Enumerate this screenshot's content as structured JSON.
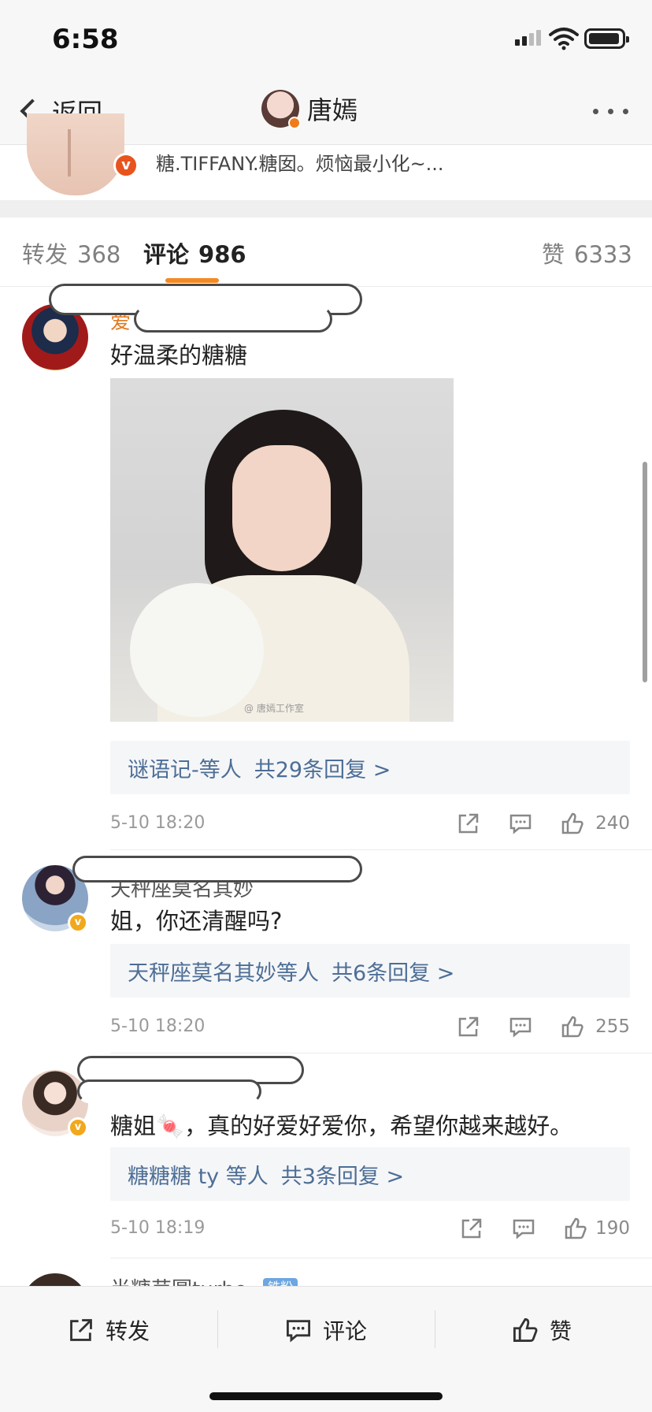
{
  "status_bar": {
    "time": "6:58"
  },
  "nav": {
    "back_label": "返回",
    "title": "唐嫣"
  },
  "profile": {
    "description": "糖.TIFFANY.糖囡。烦恼最小化~..."
  },
  "tabs": [
    {
      "label": "转发",
      "count": "368"
    },
    {
      "label": "评论",
      "count": "986"
    },
    {
      "label": "赞",
      "count": "6333"
    }
  ],
  "comments": [
    {
      "username": "爱",
      "text": "好温柔的糖糖",
      "image_watermark": "@ 唐嫣工作室",
      "replies_who": "谜语记-等人",
      "replies_count": "共29条回复 >",
      "date": "5-10 18:20",
      "likes": "240"
    },
    {
      "username": "天秤座莫名其妙",
      "text": "姐，你还清醒吗?",
      "replies_who": "天秤座莫名其妙等人",
      "replies_count": "共6条回复 >",
      "date": "5-10 18:20",
      "likes": "255"
    },
    {
      "username": "",
      "text": "糖姐🍬，真的好爱好爱你，希望你越来越好。",
      "replies_who": "糖糖糖 ty 等人",
      "replies_count": "共3条回复 >",
      "date": "5-10 18:19",
      "likes": "190"
    },
    {
      "username": "半糖芋圆turbo",
      "badge": "铁粉"
    }
  ],
  "toolbar": {
    "repost": "转发",
    "comment": "评论",
    "like": "赞"
  },
  "colors": {
    "accent": "#f28a23",
    "link": "#4d6e96",
    "name": "#e27a1f"
  }
}
